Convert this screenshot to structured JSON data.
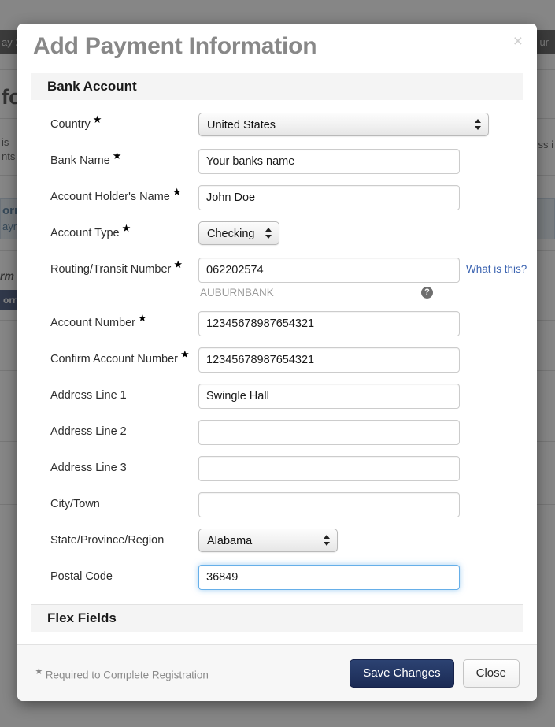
{
  "background": {
    "topbar_left": "ay 2",
    "topbar_right": "ur",
    "heading": "fo",
    "paragraph": "is\nnts",
    "right_text": "ss i",
    "alert_title": "orr",
    "alert_text": "ayn",
    "italic_text": "rm",
    "dark_button": "orr"
  },
  "modal": {
    "title": "Add Payment Information",
    "close_icon": "×",
    "sections": {
      "bank_account": "Bank Account",
      "flex_fields": "Flex Fields"
    },
    "fields": [
      {
        "label": "Country",
        "required": true,
        "type": "select",
        "value": "United States",
        "width": "wide"
      },
      {
        "label": "Bank Name",
        "required": true,
        "type": "text",
        "value": "Your banks name"
      },
      {
        "label": "Account Holder's Name",
        "required": true,
        "type": "text",
        "value": "John Doe"
      },
      {
        "label": "Account Type",
        "required": true,
        "type": "select",
        "value": "Checking",
        "width": "small"
      },
      {
        "label": "Routing/Transit Number",
        "required": true,
        "type": "text",
        "value": "062202574"
      },
      {
        "label": "Account Number",
        "required": true,
        "type": "text",
        "value": "12345678987654321"
      },
      {
        "label": "Confirm Account Number",
        "required": true,
        "type": "text",
        "value": "12345678987654321"
      },
      {
        "label": "Address Line 1",
        "required": false,
        "type": "text",
        "value": "Swingle Hall"
      },
      {
        "label": "Address Line 2",
        "required": false,
        "type": "text",
        "value": ""
      },
      {
        "label": "Address Line 3",
        "required": false,
        "type": "text",
        "value": ""
      },
      {
        "label": "City/Town",
        "required": false,
        "type": "text",
        "value": ""
      },
      {
        "label": "State/Province/Region",
        "required": false,
        "type": "select",
        "value": "Alabama",
        "width": "mid"
      },
      {
        "label": "Postal Code",
        "required": false,
        "type": "text",
        "value": "36849",
        "focused": true
      }
    ],
    "routing_help_link": "What is this?",
    "routing_bank_name": "AUBURNBANK",
    "help_icon_glyph": "?",
    "required_note": "Required to Complete Registration",
    "required_note_star": "★",
    "buttons": {
      "save": "Save Changes",
      "close": "Close"
    }
  },
  "colors": {
    "primary_button": "#1f3263",
    "link": "#3c64b1",
    "title_gray": "#888888",
    "focus_ring": "#66afe9",
    "backdrop": "#808080"
  }
}
